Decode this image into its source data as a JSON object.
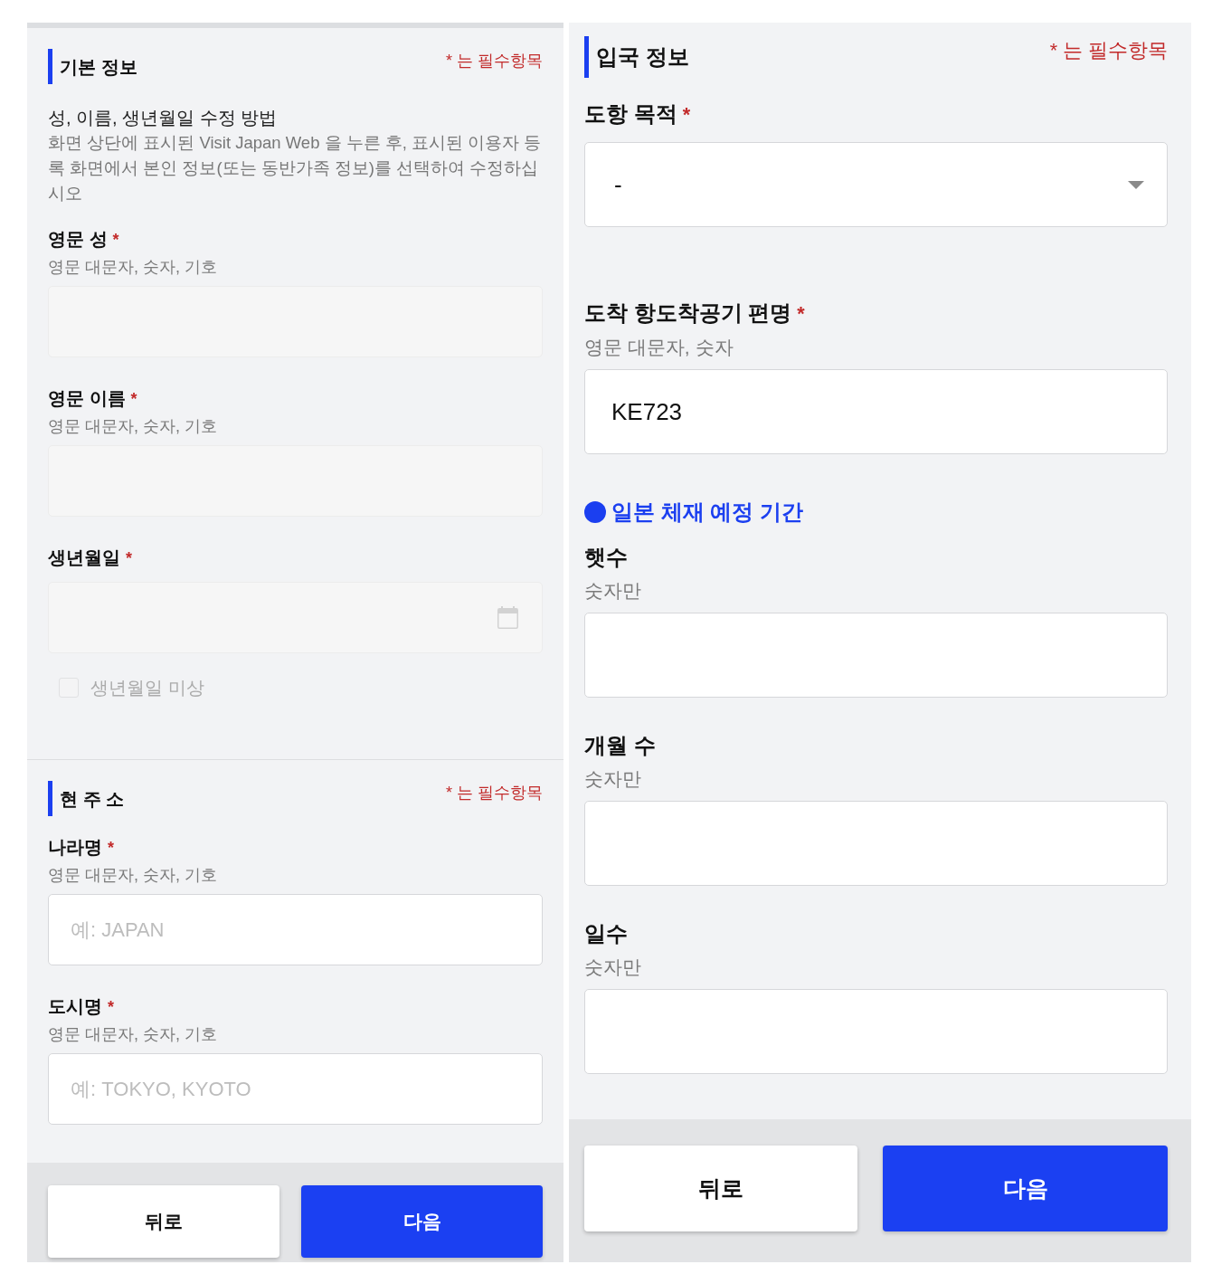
{
  "panels": [
    {
      "sections": [
        {
          "title": "기본 정보",
          "required_note": "* 는 필수항목",
          "items": [
            {
              "kind": "info",
              "heading": "성, 이름, 생년월일 수정 방법",
              "text": "화면 상단에 표시된 Visit Japan Web 을 누른 후, 표시된 이용자 등록 화면에서 본인 정보(또는 동반가족 정보)를 선택하여 수정하십시오"
            },
            {
              "kind": "text",
              "label": "영문 성",
              "mark": "*",
              "hint": "영문 대문자, 숫자, 기호",
              "disabled": true
            },
            {
              "kind": "text",
              "label": "영문 이름",
              "mark": "*",
              "hint": "영문 대문자, 숫자, 기호",
              "disabled": true
            },
            {
              "kind": "date",
              "label": "생년월일",
              "mark": "*",
              "disabled": true
            },
            {
              "kind": "checkbox",
              "label": "생년월일 미상",
              "checked": false,
              "disabled": true
            }
          ]
        },
        {
          "title": "현 주 소",
          "required_note": "* 는 필수항목",
          "items": [
            {
              "kind": "text",
              "label": "나라명",
              "mark": "*",
              "hint": "영문 대문자, 숫자, 기호",
              "placeholder": "예: JAPAN",
              "disabled": false
            },
            {
              "kind": "text",
              "label": "도시명",
              "mark": "*",
              "hint": "영문 대문자, 숫자, 기호",
              "placeholder": "예: TOKYO, KYOTO",
              "disabled": false
            }
          ]
        }
      ],
      "buttons": [
        {
          "kind": "secondary",
          "label": "뒤로"
        },
        {
          "kind": "primary",
          "label": "다음"
        }
      ]
    },
    {
      "sections": [
        {
          "title": "입국 정보",
          "required_note": "* 는 필수항목",
          "items": [
            {
              "kind": "select",
              "label": "도항 목적",
              "mark": "*",
              "value": "-",
              "disabled": false
            },
            {
              "kind": "text",
              "label": "도착 항도착공기 편명",
              "mark": "*",
              "hint": "영문 대문자, 숫자",
              "value": "KE723",
              "disabled": false
            },
            {
              "kind": "subheading",
              "text": "일본 체재 예정 기간"
            },
            {
              "kind": "text",
              "label": "햇수",
              "hint": "숫자만",
              "disabled": false
            },
            {
              "kind": "text",
              "label": "개월 수",
              "hint": "숫자만",
              "disabled": false
            },
            {
              "kind": "text",
              "label": "일수",
              "hint": "숫자만",
              "disabled": false
            }
          ]
        }
      ],
      "buttons": [
        {
          "kind": "secondary",
          "label": "뒤로"
        },
        {
          "kind": "primary",
          "label": "다음"
        }
      ]
    }
  ]
}
